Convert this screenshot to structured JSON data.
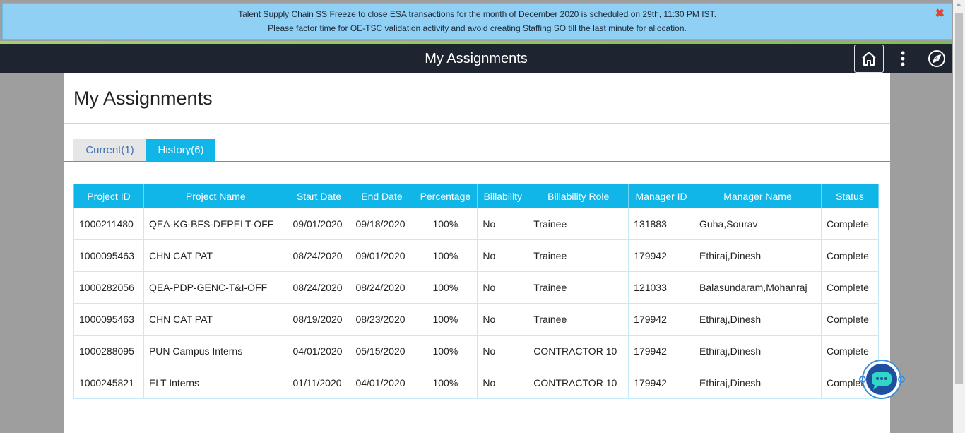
{
  "banner": {
    "line1": "Talent Supply Chain SS Freeze to close ESA transactions for the month of December 2020 is scheduled on 29th, 11:30 PM IST.",
    "line2": "Please factor time for OE-TSC validation activity and avoid creating Staffing SO till the last minute for allocation.",
    "close_icon": "✖"
  },
  "topbar": {
    "title": "My Assignments",
    "icons": [
      "home-icon",
      "more-vertical-icon",
      "compass-icon"
    ]
  },
  "page": {
    "heading": "My Assignments",
    "tabs": [
      {
        "label": "Current(1)",
        "active": false
      },
      {
        "label": "History(6)",
        "active": true
      }
    ]
  },
  "table": {
    "headers": [
      "Project ID",
      "Project Name",
      "Start Date",
      "End Date",
      "Percentage",
      "Billability",
      "Billability Role",
      "Manager ID",
      "Manager Name",
      "Status"
    ],
    "rows": [
      [
        "1000211480",
        "QEA-KG-BFS-DEPELT-OFF",
        "09/01/2020",
        "09/18/2020",
        "100%",
        "No",
        "Trainee",
        "131883",
        "Guha,Sourav",
        "Complete"
      ],
      [
        "1000095463",
        "CHN CAT PAT",
        "08/24/2020",
        "09/01/2020",
        "100%",
        "No",
        "Trainee",
        "179942",
        "Ethiraj,Dinesh",
        "Complete"
      ],
      [
        "1000282056",
        "QEA-PDP-GENC-T&I-OFF",
        "08/24/2020",
        "08/24/2020",
        "100%",
        "No",
        "Trainee",
        "121033",
        "Balasundaram,Mohanraj",
        "Complete"
      ],
      [
        "1000095463",
        "CHN CAT PAT",
        "08/19/2020",
        "08/23/2020",
        "100%",
        "No",
        "Trainee",
        "179942",
        "Ethiraj,Dinesh",
        "Complete"
      ],
      [
        "1000288095",
        "PUN Campus Interns",
        "04/01/2020",
        "05/15/2020",
        "100%",
        "No",
        "CONTRACTOR 10",
        "179942",
        "Ethiraj,Dinesh",
        "Complete"
      ],
      [
        "1000245821",
        "ELT Interns",
        "01/11/2020",
        "04/01/2020",
        "100%",
        "No",
        "CONTRACTOR 10",
        "179942",
        "Ethiraj,Dinesh",
        "Complete"
      ]
    ]
  },
  "chatbot": {
    "icon": "chatbot-icon"
  }
}
